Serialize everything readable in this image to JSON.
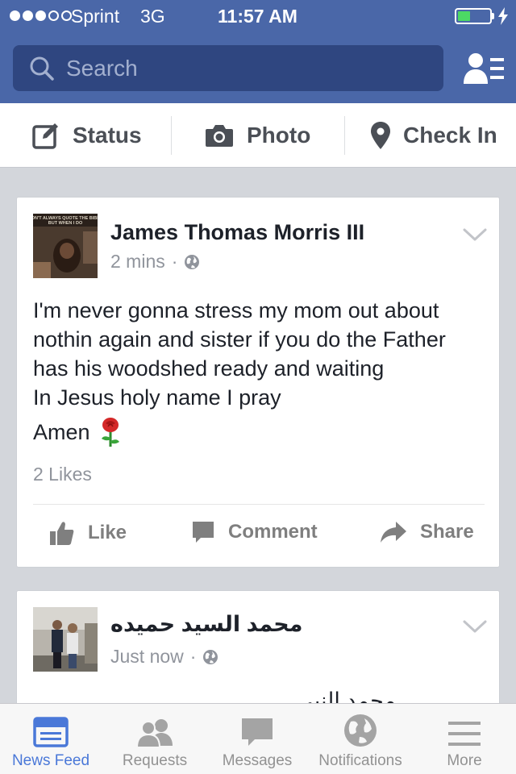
{
  "status_bar": {
    "carrier": "Sprint",
    "network": "3G",
    "time": "11:57 AM",
    "signal_bars": 3,
    "signal_total": 5,
    "battery_level": 0.4
  },
  "search": {
    "placeholder": "Search"
  },
  "composer": {
    "status_label": "Status",
    "photo_label": "Photo",
    "checkin_label": "Check In"
  },
  "posts": [
    {
      "author": "James Thomas Morris III",
      "time": "2 mins",
      "avatar_caption": "DON'T ALWAYS QUOTE THE BIBLE BUT WHEN I DO",
      "text_lines": [
        "I'm never gonna stress my mom out about",
        "nothin again and sister if you do the Father",
        "has his woodshed ready and waiting",
        "In Jesus holy name I pray"
      ],
      "amen": "Amen",
      "emoji": "rose-icon",
      "likes": "2 Likes"
    },
    {
      "author": "محمد السيد حميده",
      "time": "Just now",
      "text_preview": "محمد النبي"
    }
  ],
  "actions": {
    "like": "Like",
    "comment": "Comment",
    "share": "Share"
  },
  "tabbar": {
    "news_feed": "News Feed",
    "requests": "Requests",
    "messages": "Messages",
    "notifications": "Notifications",
    "more": "More"
  },
  "colors": {
    "header": "#4a67a8",
    "search_bg": "#2f4680",
    "active_tab": "#4a78d8",
    "battery": "#4cd964"
  }
}
